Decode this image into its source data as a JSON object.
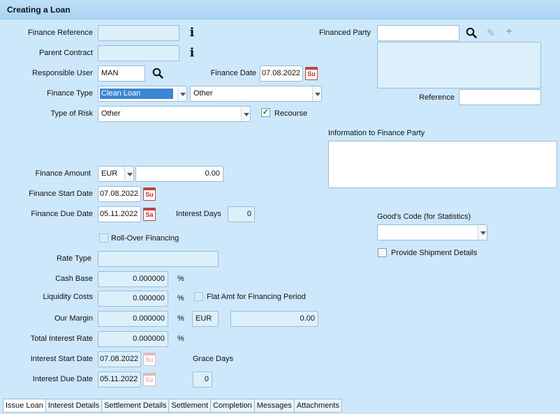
{
  "window": {
    "title": "Creating a Loan"
  },
  "left": {
    "finance_reference": {
      "label": "Finance Reference",
      "value": ""
    },
    "parent_contract": {
      "label": "Parent Contract",
      "value": ""
    },
    "responsible_user": {
      "label": "Responsible User",
      "value": "MAN"
    },
    "finance_date": {
      "label": "Finance Date",
      "value": "07.08.2022",
      "day": "Su"
    },
    "finance_type": {
      "label": "Finance Type",
      "value": "Clean Loan",
      "sub_value": "Other"
    },
    "type_of_risk": {
      "label": "Type of Risk",
      "value": "Other"
    },
    "recourse": {
      "label": "Recourse",
      "checked": true,
      "mark": "✓"
    },
    "finance_amount": {
      "label": "Finance Amount",
      "currency": "EUR",
      "value": "0.00"
    },
    "finance_start_date": {
      "label": "Finance Start Date",
      "value": "07.08.2022",
      "day": "Su"
    },
    "finance_due_date": {
      "label": "Finance Due Date",
      "value": "05.11.2022",
      "day": "Sa"
    },
    "interest_days": {
      "label": "Interest Days",
      "value": "0"
    },
    "roll_over": {
      "label": "Roll-Over Financing",
      "checked": false
    },
    "rate_type": {
      "label": "Rate Type",
      "value": ""
    },
    "cash_base": {
      "label": "Cash Base",
      "value": "0.000000",
      "unit": "%"
    },
    "liquidity_costs": {
      "label": "Liquidity Costs",
      "value": "0.000000",
      "unit": "%"
    },
    "flat_amt": {
      "label": "Flat Amt for Financing Period",
      "checked": false
    },
    "our_margin": {
      "label": "Our Margin",
      "value": "0.000000",
      "unit": "%",
      "currency": "EUR",
      "amount": "0.00"
    },
    "total_interest_rate": {
      "label": "Total Interest Rate",
      "value": "0.000000",
      "unit": "%"
    },
    "interest_start_date": {
      "label": "Interest Start Date",
      "value": "07.08.2022",
      "day": "Su"
    },
    "interest_due_date": {
      "label": "Interest Due Date",
      "value": "05.11.2022",
      "day": "Sa"
    },
    "grace_days": {
      "label": "Grace Days",
      "value": "0"
    }
  },
  "right": {
    "financed_party": {
      "label": "Financed Party",
      "value": ""
    },
    "reference": {
      "label": "Reference",
      "value": ""
    },
    "info_to_party": {
      "label": "Information to Finance Party",
      "value": ""
    },
    "goods_code": {
      "label": "Good's Code (for Statistics)",
      "value": ""
    },
    "shipment_details": {
      "label": "Provide Shipment Details",
      "checked": false
    }
  },
  "icons": {
    "info": "i",
    "pencil": "✎",
    "plus": "+"
  },
  "tabs": [
    "Issue Loan",
    "Interest Details",
    "Settlement Details",
    "Settlement",
    "Completion",
    "Messages",
    "Attachments"
  ],
  "colors": {
    "background": "#cde8fb",
    "field": "#dcf0fc",
    "selection": "#3d86d6"
  }
}
